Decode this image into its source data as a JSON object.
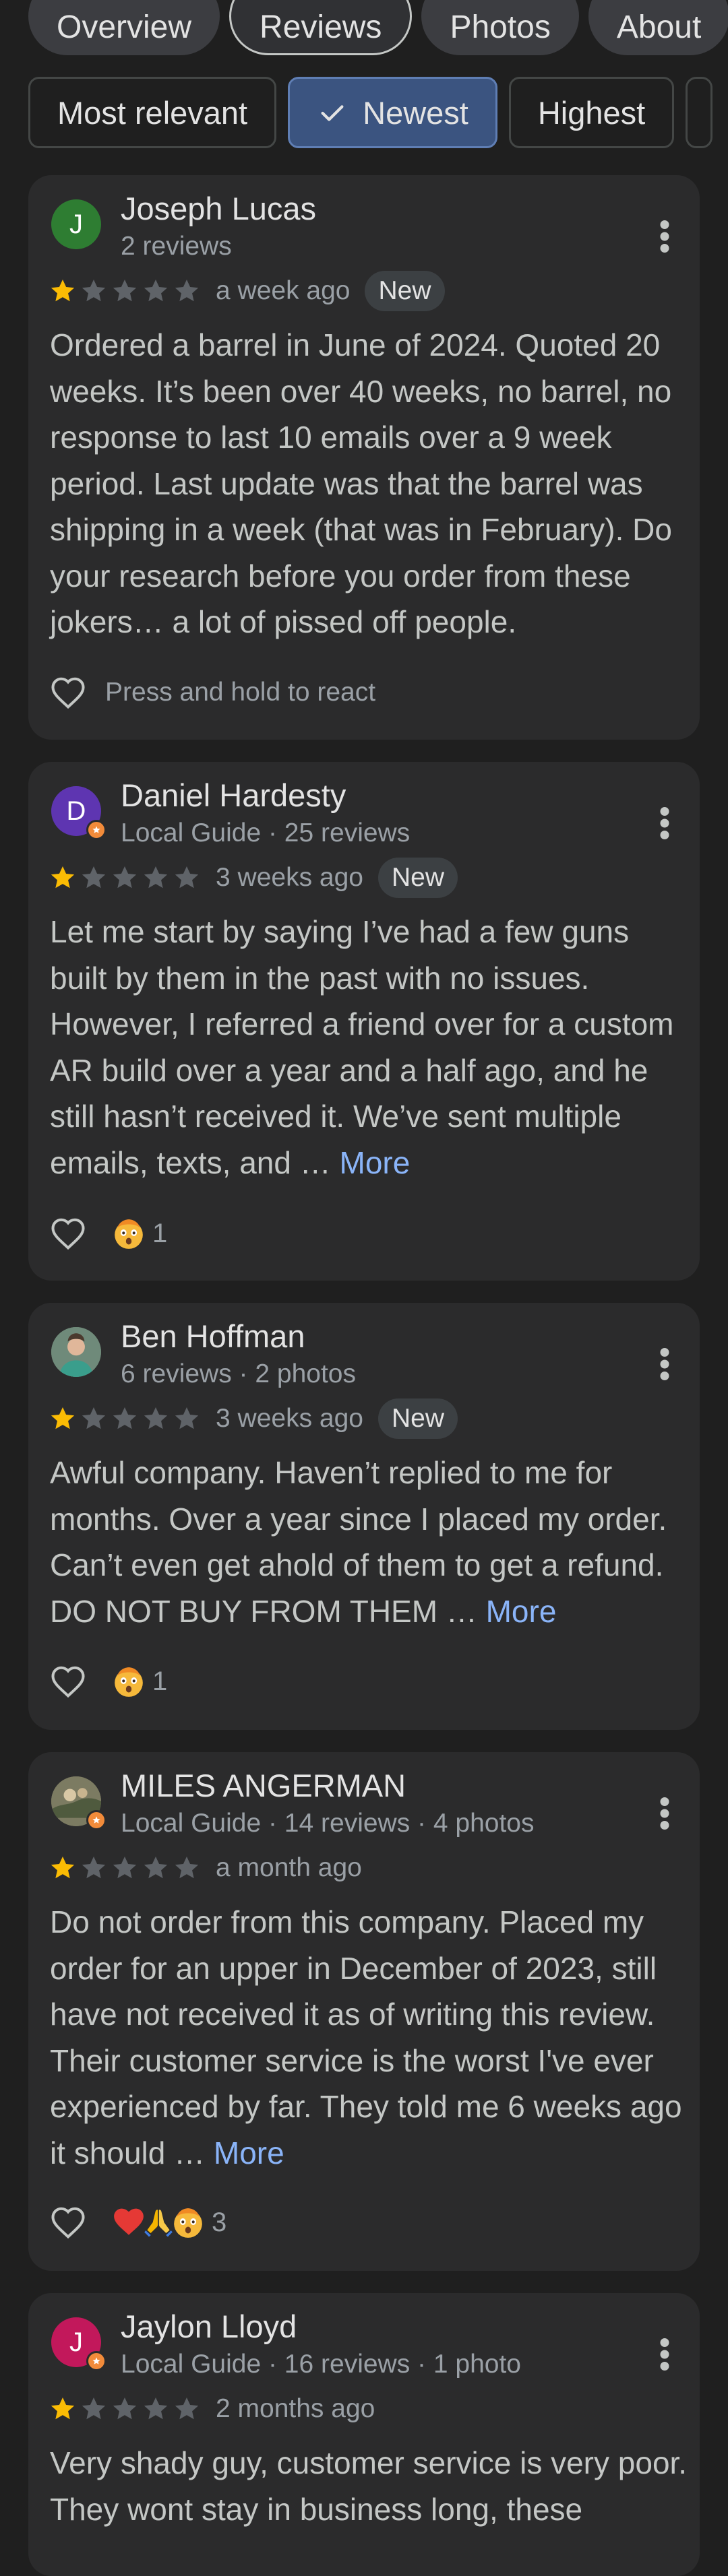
{
  "tabs": [
    {
      "label": "Overview"
    },
    {
      "label": "Reviews"
    },
    {
      "label": "Photos"
    },
    {
      "label": "About"
    }
  ],
  "filters": [
    {
      "label": "Most relevant"
    },
    {
      "label": "Newest",
      "selected": true
    },
    {
      "label": "Highest"
    }
  ],
  "colors": {
    "background": "#1f1f1f",
    "card": "#2b2b2c",
    "star_filled": "#fbbc04",
    "star_empty": "#5f6368",
    "link": "#8ab4f8",
    "selected_chip": "#3b5480",
    "local_guide_badge": "#f28b3a"
  },
  "reviews": [
    {
      "name": "Joseph Lucas",
      "meta": "2 reviews",
      "avatar_letter": "J",
      "avatar_color": "#2e7d32",
      "local_guide": false,
      "rating": 1,
      "when": "a week ago",
      "badge": "New",
      "text": "Ordered a barrel in June of 2024. Quoted 20 weeks. It’s been over 40 weeks, no barrel, no response to last 10 emails over a 9 week period. Last update was that the barrel was shipping in a week (that was in February). Do your research before you order from these jokers… a lot of pissed off people.",
      "more": "",
      "react_hint": "Press and hold to react",
      "reaction_count": ""
    },
    {
      "name": "Daniel Hardesty",
      "meta": "Local Guide · 25 reviews",
      "avatar_letter": "D",
      "avatar_color": "#5e35b1",
      "local_guide": true,
      "rating": 1,
      "when": "3 weeks ago",
      "badge": "New",
      "text": "Let me start by saying I’ve had a few guns built by them in the past with no issues. However, I referred a friend over for a custom AR build over a year and a half ago, and he still hasn’t received it. We’ve sent multiple emails, texts, and …",
      "more": "More",
      "react_hint": "",
      "reactions": [
        "shocked-face-emoji"
      ],
      "reaction_count": "1"
    },
    {
      "name": "Ben Hoffman",
      "meta": "6 reviews · 2 photos",
      "avatar_letter": "",
      "avatar_color": "#5b6b5a",
      "local_guide": false,
      "rating": 1,
      "when": "3 weeks ago",
      "badge": "New",
      "text": "Awful company. Haven’t replied to me for months. Over a year since I placed my order. Can’t even get ahold of them to get a refund. DO NOT BUY FROM THEM …",
      "more": "More",
      "react_hint": "",
      "reactions": [
        "shocked-face-emoji"
      ],
      "reaction_count": "1"
    },
    {
      "name": "MILES ANGERMAN",
      "meta": "Local Guide · 14 reviews · 4 photos",
      "avatar_letter": "",
      "avatar_color": "#6d6a52",
      "local_guide": true,
      "rating": 1,
      "when": "a month ago",
      "badge": "",
      "text": "Do not order from this company. Placed my order for an upper in December of 2023, still have not received it as of writing this review. Their customer service is the worst I've ever experienced by far. They told me 6 weeks ago it should …",
      "more": "More",
      "react_hint": "",
      "reactions": [
        "red-heart-emoji",
        "folded-hands-emoji",
        "shocked-face-emoji"
      ],
      "reaction_count": "3"
    },
    {
      "name": "Jaylon Lloyd",
      "meta": "Local Guide · 16 reviews · 1 photo",
      "avatar_letter": "J",
      "avatar_color": "#c2185b",
      "local_guide": true,
      "rating": 1,
      "when": "2 months ago",
      "badge": "",
      "text": "Very shady guy, customer service is very poor. They wont stay in business long, these",
      "more": "",
      "react_hint": "",
      "reaction_count": ""
    }
  ]
}
